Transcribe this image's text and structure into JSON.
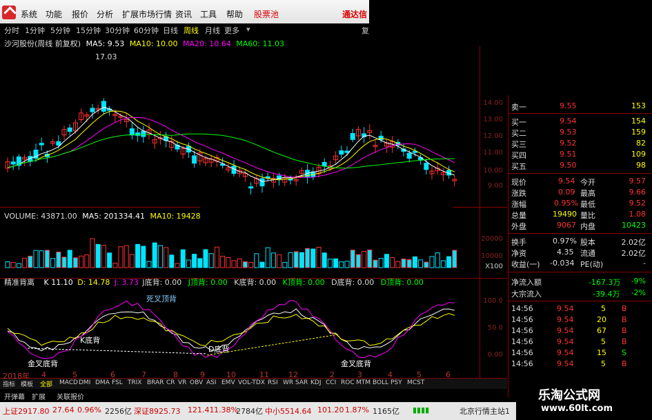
{
  "menu": {
    "items": [
      "系统",
      "功能",
      "报价",
      "分析",
      "扩展市场行情",
      "资讯",
      "工具",
      "帮助"
    ],
    "stock_pool": "股票池",
    "tongda": "通达信"
  },
  "periods": [
    "分时",
    "1分钟",
    "5分钟",
    "15分钟",
    "30分钟",
    "60分钟",
    "日线",
    "周线",
    "月线",
    "更多"
  ],
  "active_period": "周线",
  "side_label": "复",
  "main_legend": {
    "title": "沙河股份(周线 前复权)",
    "ma5": "MA5: 9.53",
    "ma10": "MA10: 10.00",
    "ma20": "MA20: 10.64",
    "ma60": "MA60: 11.03"
  },
  "price_ticks": [
    "14.00",
    "13.00",
    "12.00",
    "11.00",
    "10.00",
    "9.00"
  ],
  "high_label": "17.03",
  "volume_legend": {
    "volume": "VOLUME: 43871.00",
    "ma5": "MA5: 201334.41",
    "ma10": "MA10: 19428"
  },
  "volume_ticks": [
    "20000",
    "10000",
    "X100"
  ],
  "indicator_legend": {
    "name": "精准背离",
    "k": "K 11.10",
    "d": "D: 14.78",
    "j": "J: 3.73",
    "jdibei": "J底背: 0.00",
    "jdingbei": "J顶背: 0.00",
    "kdibei": "K底背: 0.00",
    "kdingbei": "K顶背: 0.00",
    "ddibei": "D底背: 0.00",
    "ddingbei": "D顶背: 0.00"
  },
  "indicator_ticks": [
    "100.0",
    "50.0",
    "0.00"
  ],
  "annotations": {
    "sicha": "死叉顶背",
    "kdibei": "K底背",
    "jincha1": "金叉底背",
    "jincha2": "金叉底背",
    "ddibei": "D底背"
  },
  "x_axis": {
    "year": "2018年",
    "labels": [
      "4",
      "5",
      "6",
      "7",
      "8",
      "9",
      "10",
      "11",
      "12",
      "2",
      "3",
      "4",
      "5",
      "6"
    ]
  },
  "order_book": {
    "sell": [
      {
        "label": "卖一",
        "price": "9.55",
        "vol": "153"
      }
    ],
    "buy": [
      {
        "label": "买一",
        "price": "9.54",
        "vol": "154"
      },
      {
        "label": "买二",
        "price": "9.53",
        "vol": "159"
      },
      {
        "label": "买三",
        "price": "9.52",
        "vol": "82"
      },
      {
        "label": "买四",
        "price": "9.51",
        "vol": "109"
      },
      {
        "label": "买五",
        "price": "9.50",
        "vol": "98"
      }
    ]
  },
  "quote": [
    {
      "l1": "现价",
      "v1": "9.54",
      "l2": "今开",
      "v2": "9.57"
    },
    {
      "l1": "涨跌",
      "v1": "0.09",
      "l2": "最高",
      "v2": "9.66"
    },
    {
      "l1": "涨幅",
      "v1": "0.95%",
      "l2": "最低",
      "v2": "9.52"
    },
    {
      "l1": "总量",
      "v1": "19490",
      "l2": "量比",
      "v2": "1.08"
    },
    {
      "l1": "外盘",
      "v1": "9067",
      "l2": "内盘",
      "v2": "10423"
    }
  ],
  "fundamentals": [
    {
      "l1": "换手",
      "v1": "0.97%",
      "l2": "股本",
      "v2": "2.02亿"
    },
    {
      "l1": "净资",
      "v1": "4.35",
      "l2": "流通",
      "v2": "2.02亿"
    },
    {
      "l1": "收益(一)",
      "v1": "-0.034",
      "l2": "PE(动)",
      "v2": "-"
    }
  ],
  "flows": [
    {
      "label": "净流入额",
      "value": "-167.3万",
      "pct": "-9%"
    },
    {
      "label": "大宗流入",
      "value": "-39.4万",
      "pct": "-2%"
    }
  ],
  "ticks": [
    {
      "time": "14:56",
      "price": "9.54",
      "vol": "5",
      "side": "B"
    },
    {
      "time": "14:56",
      "price": "9.54",
      "vol": "20",
      "side": "B"
    },
    {
      "time": "14:56",
      "price": "9.54",
      "vol": "67",
      "side": "B"
    },
    {
      "time": "14:56",
      "price": "9.54",
      "vol": "5",
      "side": "B"
    },
    {
      "time": "14:56",
      "price": "9.54",
      "vol": "15",
      "side": "S"
    },
    {
      "time": "14:56",
      "price": "9.54",
      "vol": "5",
      "side": "B"
    }
  ],
  "tabs": [
    "指标",
    "模板",
    "全部",
    "MACD",
    "DMI",
    "DMA",
    "FSL",
    "TRIX",
    "BRAR",
    "CR",
    "VR",
    "OBV",
    "ASI",
    "EMV",
    "VOL-TDX",
    "RSI",
    "WR",
    "SAR",
    "KDJ",
    "CCI",
    "ROC",
    "MTM",
    "BOLL",
    "PSY",
    "MCST"
  ],
  "active_tab": "全部",
  "subtabs": [
    "开弹幕",
    "扩展",
    "关联报价"
  ],
  "status": {
    "sh": "上证2917.80",
    "sh_chg": "27.64",
    "sh_pct": "0.96%",
    "sh_amt": "2256亿",
    "sz": "深证8925.73",
    "sz_chg": "121.41",
    "sz_pct": "1.38%",
    "sz_amt": "2784亿",
    "zx": "中小5514.64",
    "zx_chg": "101.20",
    "zx_pct": "1.87%",
    "zx_amt": "1165亿",
    "server": "北京行情主站1"
  },
  "brand": {
    "name": "乐淘公式网",
    "url": "www.60lt.com"
  },
  "colors": {
    "up": "#ff3232",
    "down": "#00e5ff",
    "ma5": "#ffffff",
    "ma10": "#ffff00",
    "ma20": "#ff00ff",
    "ma60": "#00ff00",
    "grid": "#8b0000"
  }
}
